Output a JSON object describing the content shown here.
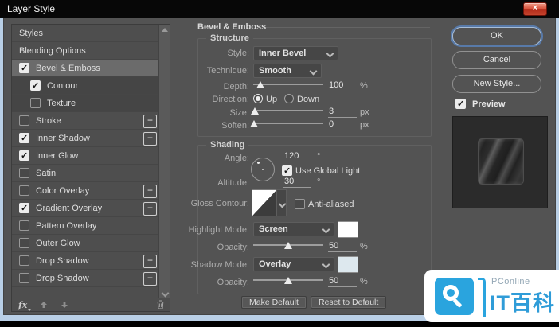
{
  "window": {
    "title": "Layer Style",
    "close_glyph": "×"
  },
  "sidebar": {
    "items": [
      {
        "label": "Styles"
      },
      {
        "label": "Blending Options"
      },
      {
        "label": "Bevel & Emboss"
      },
      {
        "label": "Contour"
      },
      {
        "label": "Texture"
      },
      {
        "label": "Stroke"
      },
      {
        "label": "Inner Shadow"
      },
      {
        "label": "Inner Glow"
      },
      {
        "label": "Satin"
      },
      {
        "label": "Color Overlay"
      },
      {
        "label": "Gradient Overlay"
      },
      {
        "label": "Pattern Overlay"
      },
      {
        "label": "Outer Glow"
      },
      {
        "label": "Drop Shadow"
      },
      {
        "label": "Drop Shadow"
      }
    ],
    "footer": {
      "fx_label": "fx"
    }
  },
  "main": {
    "title": "Bevel & Emboss",
    "structure": {
      "legend": "Structure",
      "style_label": "Style:",
      "style_value": "Inner Bevel",
      "technique_label": "Technique:",
      "technique_value": "Smooth",
      "depth_label": "Depth:",
      "depth_value": "100",
      "depth_unit": "%",
      "direction_label": "Direction:",
      "direction_up": "Up",
      "direction_down": "Down",
      "size_label": "Size:",
      "size_value": "3",
      "size_unit": "px",
      "soften_label": "Soften:",
      "soften_value": "0",
      "soften_unit": "px"
    },
    "shading": {
      "legend": "Shading",
      "angle_label": "Angle:",
      "angle_value": "120",
      "angle_unit": "°",
      "use_global_light_label": "Use Global Light",
      "altitude_label": "Altitude:",
      "altitude_value": "30",
      "altitude_unit": "°",
      "gloss_contour_label": "Gloss Contour:",
      "anti_aliased_label": "Anti-aliased",
      "highlight_mode_label": "Highlight Mode:",
      "highlight_mode_value": "Screen",
      "highlight_swatch": "#ffffff",
      "highlight_opacity_label": "Opacity:",
      "highlight_opacity_value": "50",
      "highlight_opacity_unit": "%",
      "shadow_mode_label": "Shadow Mode:",
      "shadow_mode_value": "Overlay",
      "shadow_swatch": "#dde8ee",
      "shadow_opacity_label": "Opacity:",
      "shadow_opacity_value": "50",
      "shadow_opacity_unit": "%"
    },
    "footer_buttons": {
      "make_default": "Make Default",
      "reset_to_default": "Reset to Default"
    }
  },
  "actions": {
    "ok": "OK",
    "cancel": "Cancel",
    "new_style": "New Style...",
    "preview_label": "Preview"
  },
  "watermark": {
    "brand": "PConline",
    "title": "IT百科"
  },
  "colors": {
    "dialog_bg": "#535353",
    "aero_border": "#b9cfe6",
    "accent_blue": "#2aa4de",
    "highlight_swatch": "#ffffff",
    "shadow_swatch": "#dde8ee"
  }
}
